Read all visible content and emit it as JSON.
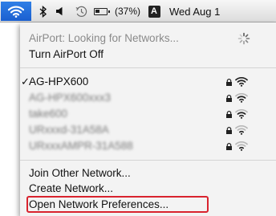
{
  "menubar": {
    "battery_percent": "(37%)",
    "input_source": "A",
    "clock": "Wed Aug 1"
  },
  "airport": {
    "status": "AirPort: Looking for Networks...",
    "toggle": "Turn AirPort Off"
  },
  "networks": [
    {
      "name": "AG-HPX600",
      "connected": true,
      "secured": true,
      "signal": 4,
      "redacted": false
    },
    {
      "name": "AG-HPX600xxx3",
      "connected": false,
      "secured": true,
      "signal": 3,
      "redacted": true
    },
    {
      "name": "take600",
      "connected": false,
      "secured": true,
      "signal": 3,
      "redacted": true
    },
    {
      "name": "URxxxd-31A58A",
      "connected": false,
      "secured": true,
      "signal": 2,
      "redacted": true
    },
    {
      "name": "URxxxAMPR-31A588",
      "connected": false,
      "secured": true,
      "signal": 2,
      "redacted": true
    }
  ],
  "actions": {
    "join": "Join Other Network...",
    "create": "Create Network...",
    "preferences": "Open Network Preferences..."
  },
  "colors": {
    "selection_blue": "#1f66d6",
    "highlight_red": "#d9232e"
  }
}
